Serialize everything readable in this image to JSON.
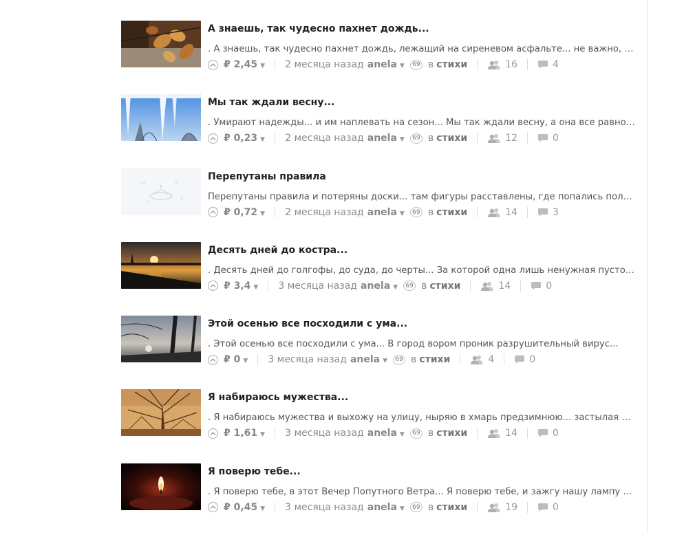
{
  "posts": [
    {
      "title": "А знаешь, так чудесно пахнет дождь...",
      "excerpt": ". А знаешь, так чудесно пахнет дождь, лежащий на сиреневом асфальте... не важно, чт...",
      "price": "₽ 2,45",
      "time": "2 месяца назад",
      "author": "anela",
      "author_badge": "69",
      "in_label": "в",
      "category": "стихи",
      "readers": "16",
      "comments": "4",
      "thumb": "autumn-leaves"
    },
    {
      "title": "Мы так ждали весну...",
      "excerpt": ". Умирают надежды... и им наплевать на сезон... Мы так ждали весну, а она все равно г...",
      "price": "₽ 0,23",
      "time": "2 месяца назад",
      "author": "anela",
      "author_badge": "69",
      "in_label": "в",
      "category": "стихи",
      "readers": "12",
      "comments": "0",
      "thumb": "icicles-sky"
    },
    {
      "title": "Перепутаны правила",
      "excerpt": "Перепутаны правила и потеряны доски... там фигуры расставлены, где попались полос...",
      "price": "₽ 0,72",
      "time": "2 месяца назад",
      "author": "anela",
      "author_badge": "69",
      "in_label": "в",
      "category": "стихи",
      "readers": "14",
      "comments": "3",
      "thumb": "placeholder-ufo"
    },
    {
      "title": "Десять дней до костра...",
      "excerpt": ". Десять дней до голгофы, до суда, до черты... За которой одна лишь ненужная пустош...",
      "price": "₽ 3,4",
      "time": "3 месяца назад",
      "author": "anela",
      "author_badge": "69",
      "in_label": "в",
      "category": "стихи",
      "readers": "14",
      "comments": "0",
      "thumb": "sunset-lake"
    },
    {
      "title": "Этой осенью все посходили с ума...",
      "excerpt": ". Этой осенью все посходили с ума... В город вором проник разрушительный вирус...",
      "price": "₽ 0",
      "time": "3 месяца назад",
      "author": "anela",
      "author_badge": "69",
      "in_label": "в",
      "category": "стихи",
      "readers": "4",
      "comments": "0",
      "thumb": "bare-tree-dusk"
    },
    {
      "title": "Я набираюсь мужества...",
      "excerpt": ". Я набираюсь мужества и выхожу на улицу, ныряю в хмарь предзимнюю... застылая М...",
      "price": "₽ 1,61",
      "time": "3 месяца назад",
      "author": "anela",
      "author_badge": "69",
      "in_label": "в",
      "category": "стихи",
      "readers": "14",
      "comments": "0",
      "thumb": "sepia-branches"
    },
    {
      "title": "Я поверю тебе...",
      "excerpt": ". Я поверю тебе, в этот Вечер Попутного Ветра... Я поверю тебе, и зажгу нашу лампу в ...",
      "price": "₽ 0,45",
      "time": "3 месяца назад",
      "author": "anela",
      "author_badge": "69",
      "in_label": "в",
      "category": "стихи",
      "readers": "19",
      "comments": "0",
      "thumb": "candle-flame"
    }
  ],
  "colors": {
    "title": "#222222",
    "meta": "#8a8a8a",
    "separator": "#dddddd"
  },
  "icons": {
    "vote": "up-chevron-circle-icon",
    "readers": "users-icon",
    "comments": "comment-bubble-icon",
    "price_menu": "caret-down-icon"
  }
}
